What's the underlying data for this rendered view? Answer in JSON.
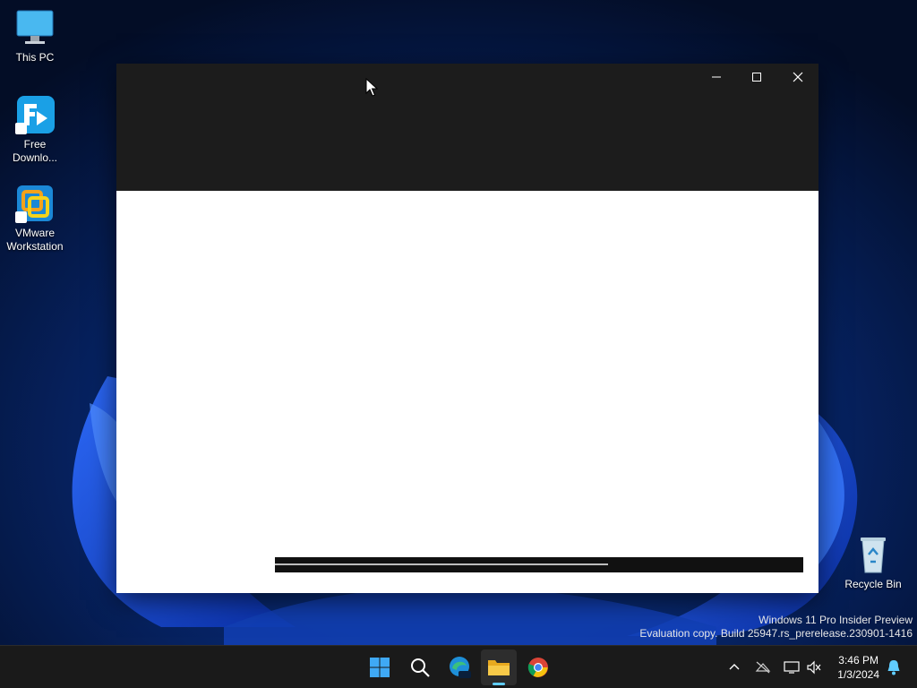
{
  "desktop": {
    "icons": [
      {
        "label": "This PC",
        "icon": "this-pc-icon"
      },
      {
        "label": "Free Downlo...",
        "icon": "free-download-manager-icon"
      },
      {
        "label": "VMware Workstation",
        "icon": "vmware-icon"
      },
      {
        "label": "Recycle Bin",
        "icon": "recycle-bin-icon"
      }
    ],
    "watermark": {
      "line1": "Windows 11 Pro Insider Preview",
      "line2": "Evaluation copy. Build 25947.rs_prerelease.230901-1416"
    }
  },
  "window": {
    "controls": [
      "minimize-icon",
      "maximize-icon",
      "close-icon"
    ],
    "progress": 0.63
  },
  "taskbar": {
    "apps": [
      "start-icon",
      "search-icon",
      "edge-beta-icon",
      "file-explorer-icon",
      "chrome-icon"
    ],
    "active_app": "file-explorer-icon",
    "tray": [
      "chevron-up-icon",
      "network-off-icon",
      "display-icon",
      "volume-muted-icon"
    ],
    "clock": {
      "time": "3:46 PM",
      "date": "1/3/2024"
    }
  },
  "colors": {
    "desktop_bg": "#05122e",
    "titlebar": "#1c1c1c",
    "taskbar": "#1a1a1a",
    "accent": "#60cdff"
  }
}
